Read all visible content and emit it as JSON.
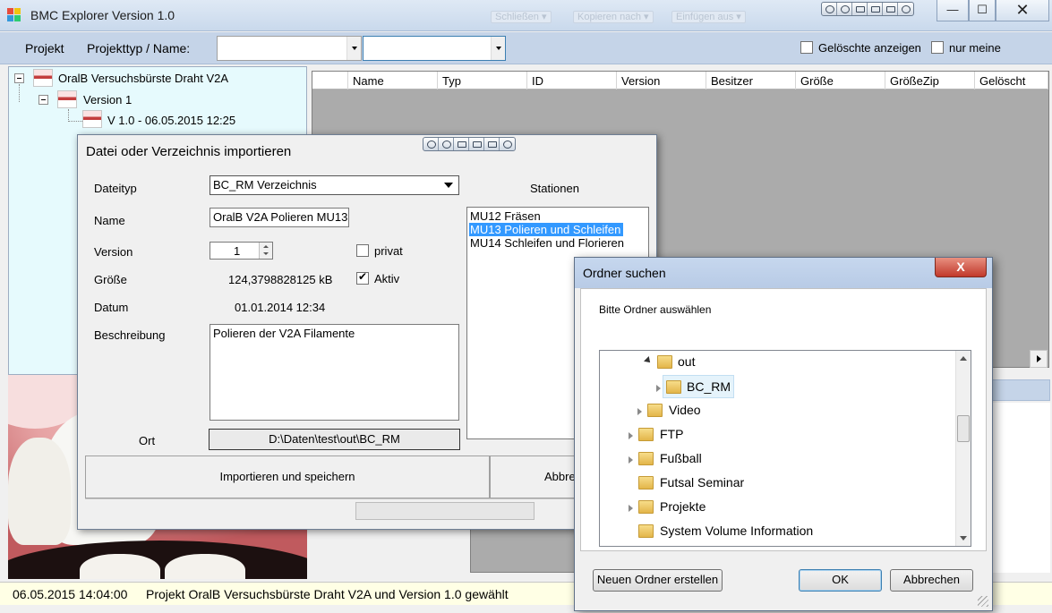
{
  "window": {
    "title": "BMC Explorer Version 1.0",
    "ghost_toolbar": [
      "Schließen ▾",
      "Kopieren nach ▾",
      "Einfügen aus ▾"
    ],
    "controls": {
      "minimize": "—",
      "maximize": "☐",
      "close": "✕"
    }
  },
  "toolbar": {
    "projekt_label": "Projekt",
    "projekttyp_label": "Projekttyp / Name:",
    "typ_value": "",
    "name_value": "",
    "geloeschte_label": "Gelöschte anzeigen",
    "nur_meine_label": "nur meine",
    "geloeschte_checked": false,
    "nur_meine_checked": false
  },
  "tree": {
    "root": "OralB Versuchsbürste Draht V2A",
    "child": "Version 1",
    "leaf": "V 1.0  -  06.05.2015 12:25"
  },
  "grid": {
    "columns": [
      "Name",
      "Typ",
      "ID",
      "Version",
      "Besitzer",
      "Größe",
      "GrößeZip",
      "Gelöscht"
    ]
  },
  "status": {
    "time": "06.05.2015 14:04:00",
    "message": "Projekt OralB Versuchsbürste Draht V2A und Version 1.0 gewählt"
  },
  "import_dialog": {
    "title": "Datei oder Verzeichnis importieren",
    "dateityp_label": "Dateityp",
    "dateityp_value": "BC_RM Verzeichnis",
    "stationen_label": "Stationen",
    "name_label": "Name",
    "name_value": "OralB V2A Polieren MU13",
    "version_label": "Version",
    "version_value": "1",
    "privat_label": "privat",
    "privat_checked": false,
    "groesse_label": "Größe",
    "groesse_value": "124,3798828125 kB",
    "aktiv_label": "Aktiv",
    "aktiv_checked": true,
    "datum_label": "Datum",
    "datum_value": "01.01.2014 12:34",
    "beschreibung_label": "Beschreibung",
    "beschreibung_value": "Polieren der V2A Filamente",
    "ort_label": "Ort",
    "ort_value": "D:\\Daten\\test\\out\\BC_RM",
    "stationen": [
      {
        "label": "MU12 Fräsen",
        "selected": false
      },
      {
        "label": "MU13 Polieren und Schleifen",
        "selected": true
      },
      {
        "label": "MU14 Schleifen und Florieren",
        "selected": false
      }
    ],
    "import_button": "Importieren und speichern",
    "cancel_button": "Abbre"
  },
  "folder_dialog": {
    "title": "Ordner suchen",
    "close_label": "X",
    "instruction": "Bitte Ordner auswählen",
    "folders": [
      {
        "name": "out",
        "level": 1,
        "expanded": true,
        "has_children": true,
        "selected": false
      },
      {
        "name": "BC_RM",
        "level": 2,
        "expanded": false,
        "has_children": true,
        "selected": true
      },
      {
        "name": "Video",
        "level": 0,
        "expanded": false,
        "has_children": true,
        "selected": false
      },
      {
        "name": "FTP",
        "level": -1,
        "expanded": false,
        "has_children": true,
        "selected": false
      },
      {
        "name": "Fußball",
        "level": -1,
        "expanded": false,
        "has_children": true,
        "selected": false
      },
      {
        "name": "Futsal Seminar",
        "level": -1,
        "expanded": false,
        "has_children": false,
        "selected": false
      },
      {
        "name": "Projekte",
        "level": -1,
        "expanded": false,
        "has_children": true,
        "selected": false
      },
      {
        "name": "System Volume Information",
        "level": -1,
        "expanded": false,
        "has_children": false,
        "selected": false
      }
    ],
    "new_folder_button": "Neuen Ordner erstellen",
    "ok_button": "OK",
    "cancel_button": "Abbrechen"
  }
}
